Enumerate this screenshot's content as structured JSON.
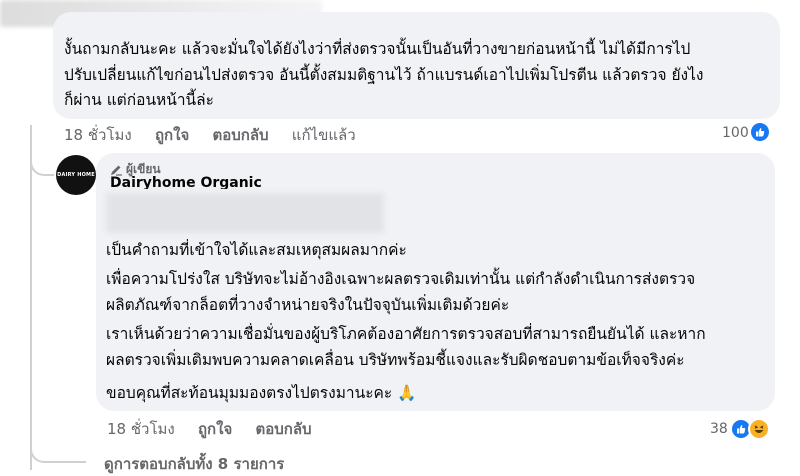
{
  "comment1": {
    "text_lines": [
      "งั้นถามกลับนะคะ แล้วจะมั่นใจได้ยังไงว่าที่ส่งตรวจนั้นเป็นอันที่วางขายก่อนหน้านี้ ไม่ได้มีการไป",
      "ปรับเปลี่ยนแก้ไขก่อนไปส่งตรวจ อันนี้ตั้งสมมติฐานไว้ ถ้าแบรนด์เอาไปเพิ่มโปรตีน แล้วตรวจ ยังไง",
      "ก็ผ่าน แต่ก่อนหน้านี้ล่ะ"
    ],
    "time": "18 ชั่วโมง",
    "like_label": "ถูกใจ",
    "reply_label": "ตอบกลับ",
    "edited_label": "แก้ไขแล้ว",
    "reaction_count": "100"
  },
  "reply": {
    "avatar_text": "DAIRY HOME",
    "author_badge": "ผู้เขียน",
    "author_name": "Dairyhome Organic",
    "paragraphs": [
      [
        "เป็นคำถามที่เข้าใจได้และสมเหตุสมผลมากค่ะ"
      ],
      [
        "เพื่อความโปร่งใส บริษัทจะไม่อ้างอิงเฉพาะผลตรวจเดิมเท่านั้น แต่กำลังดำเนินการส่งตรวจ",
        "ผลิตภัณฑ์จากล็อตที่วางจำหน่ายจริงในปัจจุบันเพิ่มเติมด้วยค่ะ"
      ],
      [
        "เราเห็นด้วยว่าความเชื่อมั่นของผู้บริโภคต้องอาศัยการตรวจสอบที่สามารถยืนยันได้ และหาก",
        "ผลตรวจเพิ่มเติมพบความคลาดเคลื่อน บริษัทพร้อมชี้แจงและรับผิดชอบตามข้อเท็จจริงค่ะ"
      ],
      [
        "ขอบคุณที่สะท้อนมุมมองตรงไปตรงมานะคะ 🙏"
      ]
    ],
    "time": "18 ชั่วโมง",
    "like_label": "ถูกใจ",
    "reply_label": "ตอบกลับ",
    "reaction_count": "38"
  },
  "view_replies_label": "ดูการตอบกลับทั้ง 8 รายการ",
  "colors": {
    "bubble": "#f0f2f5",
    "like_blue": "#1877f2",
    "meta_gray": "#65676b"
  }
}
